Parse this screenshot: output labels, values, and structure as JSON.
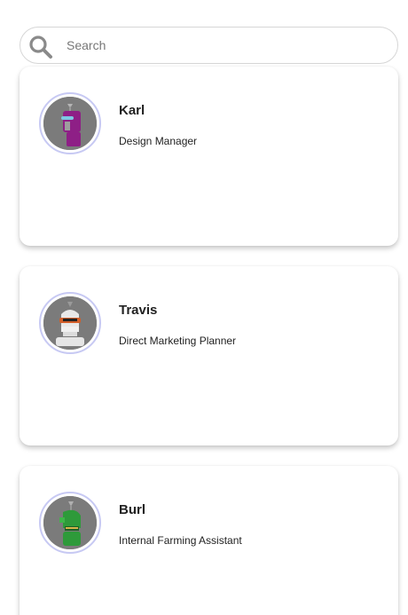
{
  "search": {
    "placeholder": "Search",
    "icon": "search-icon"
  },
  "profiles": [
    {
      "name": "Karl",
      "role": "Design Manager",
      "avatar_color": "#8e1f86"
    },
    {
      "name": "Travis",
      "role": "Direct Marketing Planner",
      "avatar_color": "#e8e8e8"
    },
    {
      "name": "Burl",
      "role": "Internal Farming Assistant",
      "avatar_color": "#2e9a3a"
    }
  ]
}
